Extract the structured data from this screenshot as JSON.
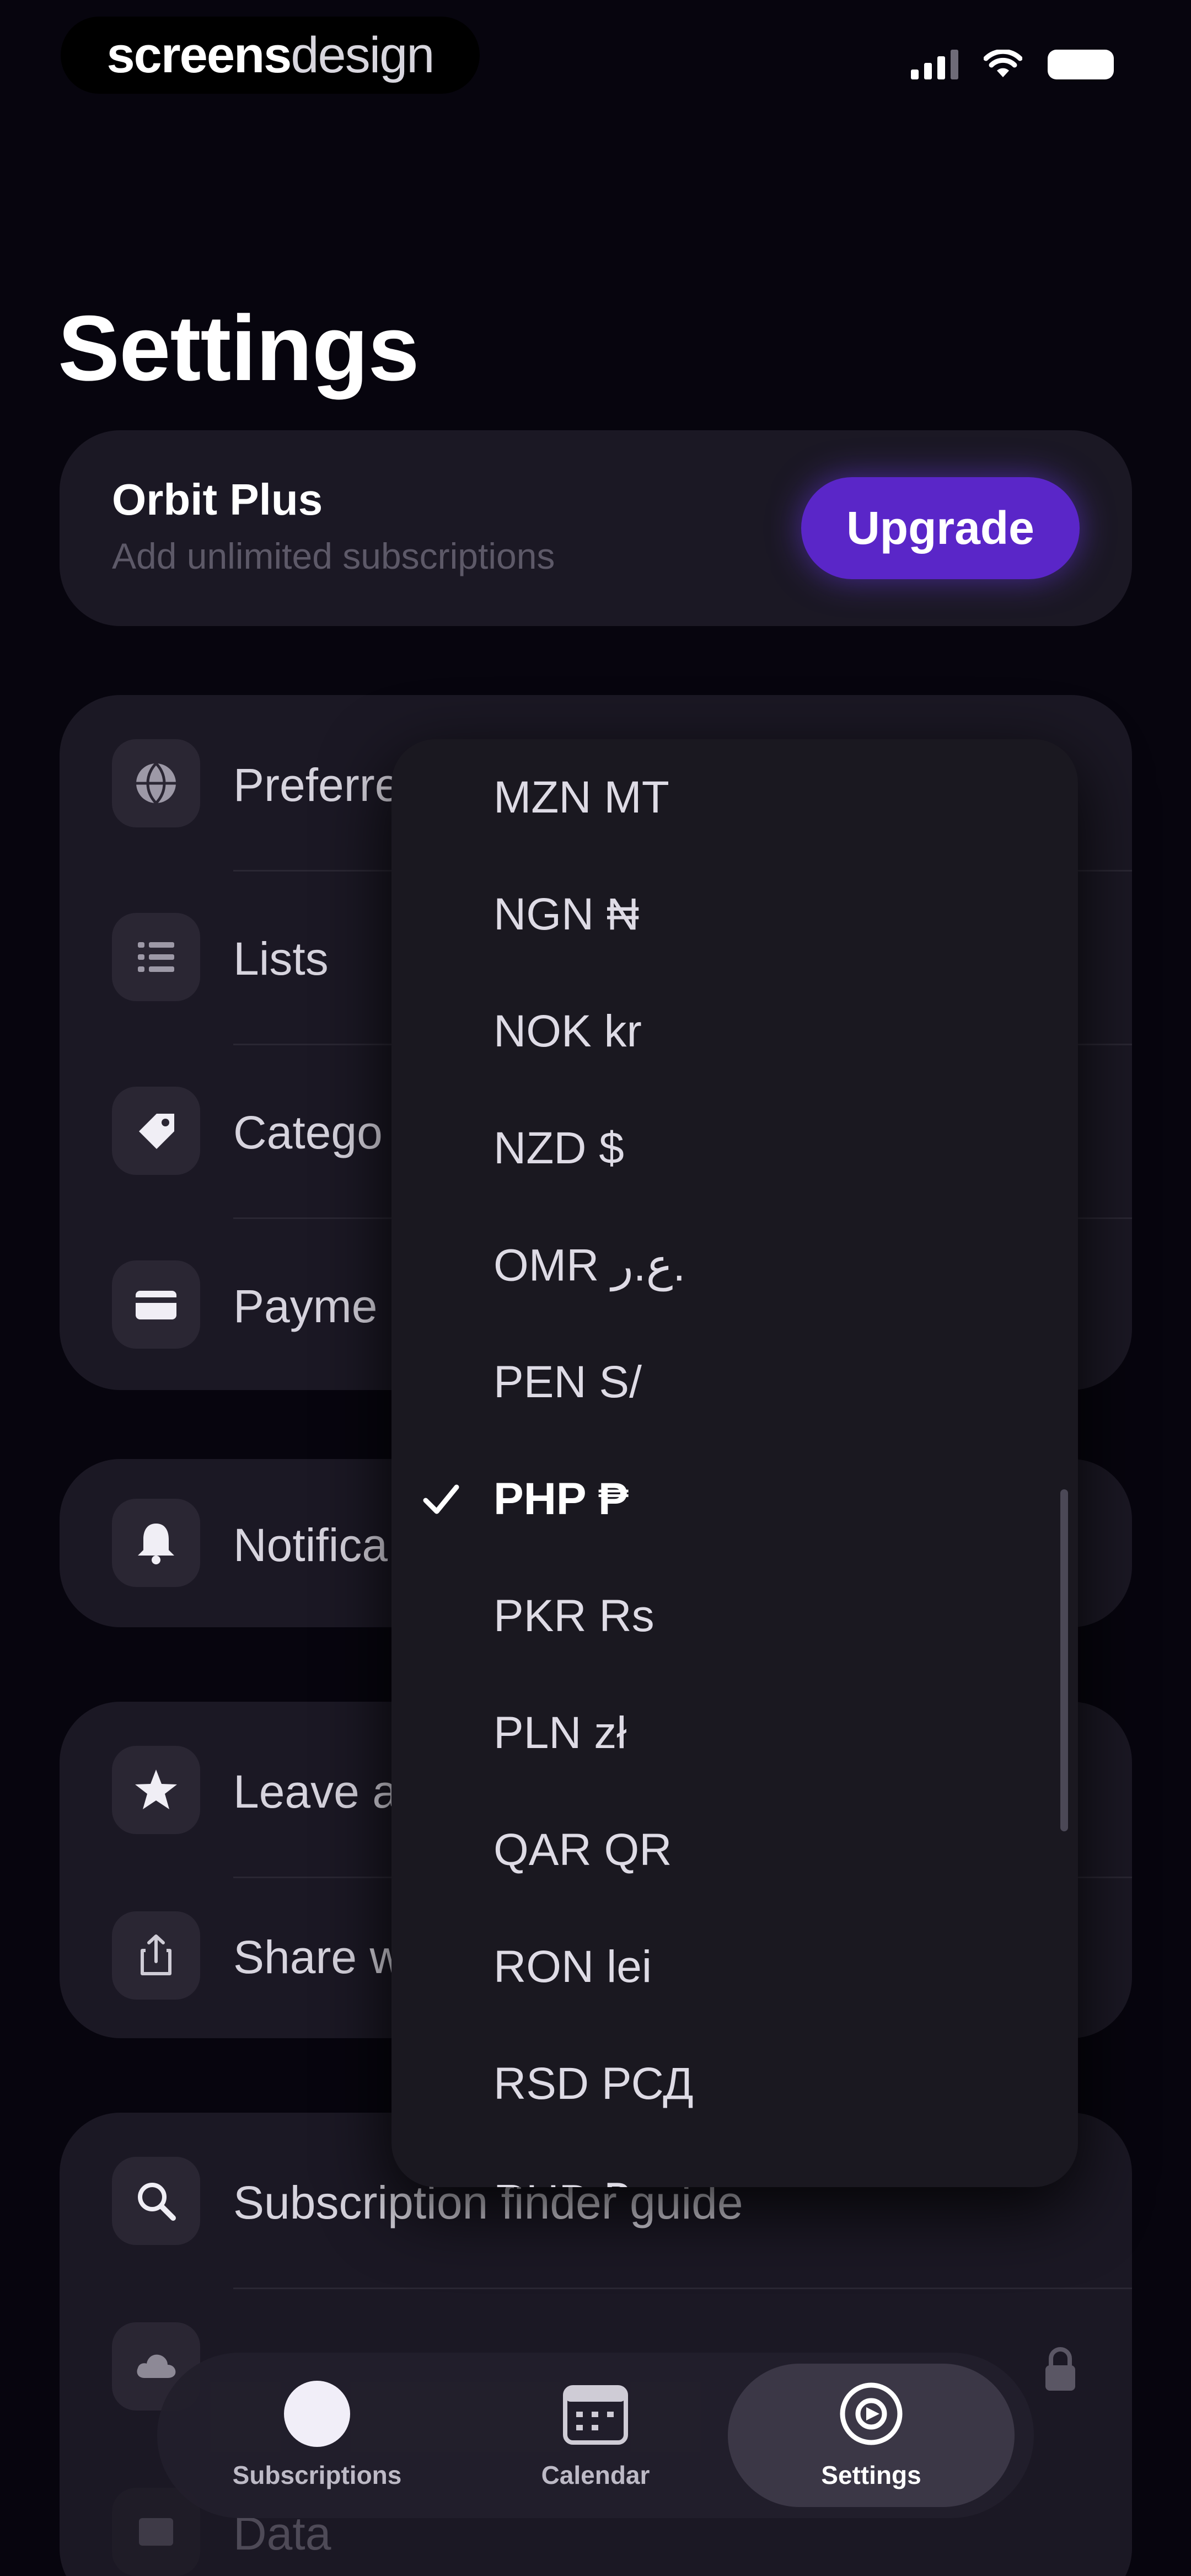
{
  "status": {
    "brand_part1": "screens",
    "brand_part2": "design"
  },
  "page": {
    "title": "Settings"
  },
  "plus_card": {
    "title": "Orbit Plus",
    "subtitle": "Add unlimited subscriptions",
    "upgrade_label": "Upgrade"
  },
  "settings_groups": {
    "preferences": [
      {
        "label": "Preferred",
        "icon": "globe-icon"
      },
      {
        "label": "Lists",
        "icon": "list-icon"
      },
      {
        "label": "Catego",
        "icon": "tag-icon"
      },
      {
        "label": "Payme",
        "icon": "card-icon"
      }
    ],
    "notifications": [
      {
        "label": "Notifica",
        "icon": "bell-icon"
      }
    ],
    "rating": [
      {
        "label": "Leave a",
        "icon": "star-icon"
      },
      {
        "label": "Share w",
        "icon": "share-icon"
      }
    ],
    "tools": [
      {
        "label": "Subscription finder guide",
        "icon": "search-icon"
      },
      {
        "label": "Data",
        "icon": "data-icon"
      }
    ]
  },
  "currency_dropdown": {
    "selected": "PHP ₱",
    "options": [
      "MZN MT",
      "NGN ₦",
      "NOK kr",
      "NZD $",
      "OMR ع.ر.",
      "PEN S/",
      "PHP ₱",
      "PKR Rs",
      "PLN zł",
      "QAR QR",
      "RON lei",
      "RSD РСД",
      "RUB ₽"
    ]
  },
  "tab_bar": {
    "items": [
      {
        "label": "Subscriptions"
      },
      {
        "label": "Calendar"
      },
      {
        "label": "Settings"
      }
    ],
    "active": "Settings"
  },
  "colors": {
    "background": "#07050e",
    "card": "#1b1824",
    "accent": "#5a26c8",
    "dropdown": "#1a1820"
  }
}
